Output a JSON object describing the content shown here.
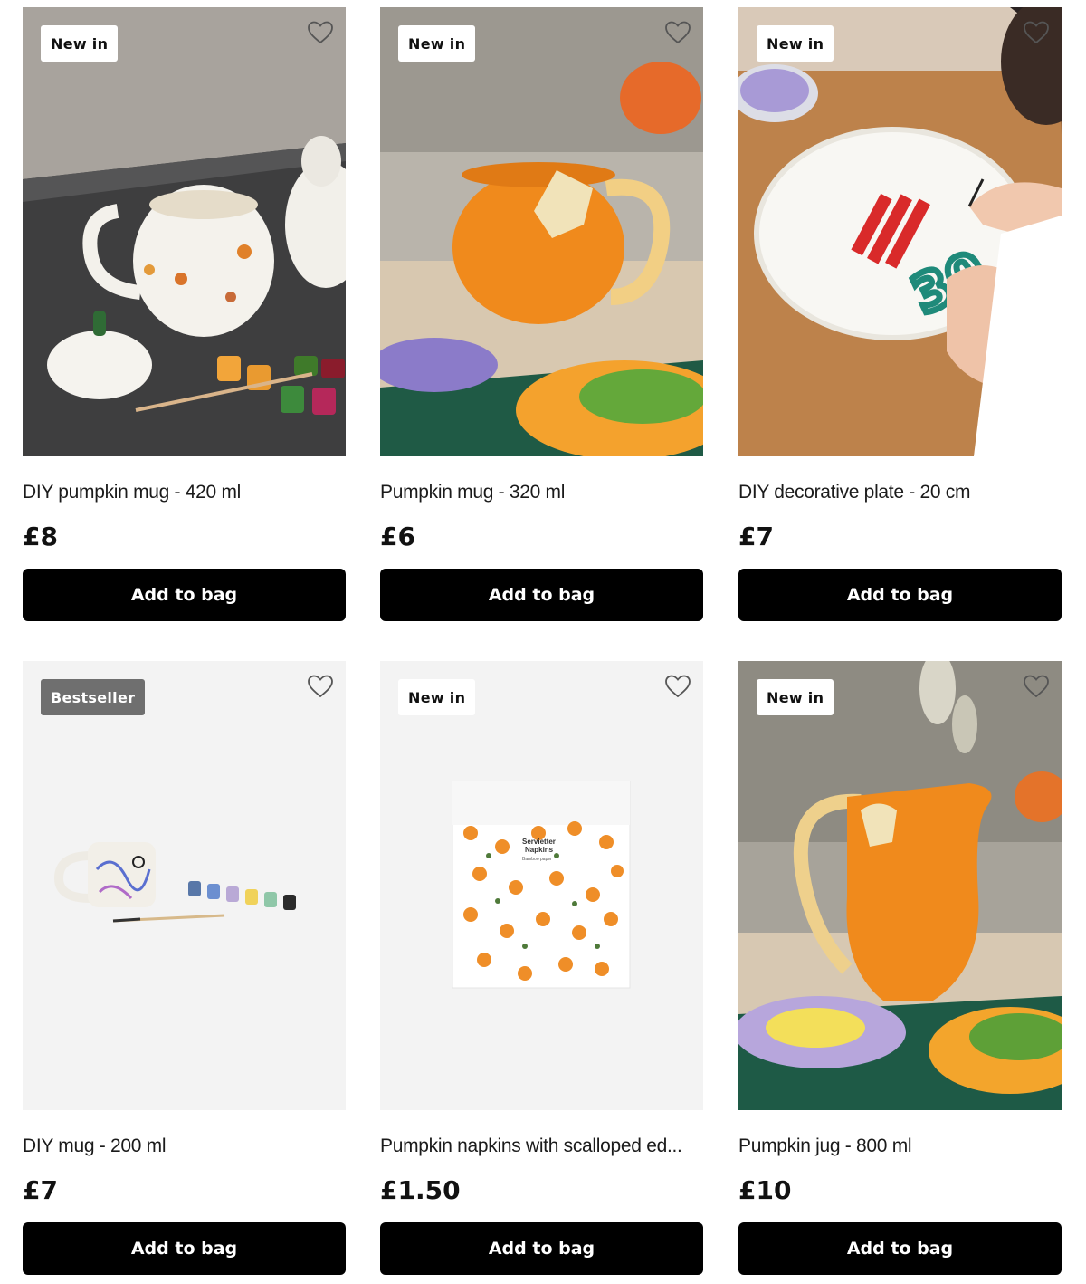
{
  "products": [
    {
      "name": "DIY pumpkin mug - 420 ml",
      "price": "£8",
      "badge": "New in",
      "button": "Add to bag"
    },
    {
      "name": "Pumpkin mug - 320 ml",
      "price": "£6",
      "badge": "New in",
      "button": "Add to bag"
    },
    {
      "name": "DIY decorative plate - 20 cm",
      "price": "£7",
      "badge": "New in",
      "button": "Add to bag"
    },
    {
      "name": "DIY mug - 200 ml",
      "price": "£7",
      "badge": "Bestseller",
      "button": "Add to bag"
    },
    {
      "name": "Pumpkin napkins with scalloped ed...",
      "price": "£1.50",
      "badge": "New in",
      "button": "Add to bag"
    },
    {
      "name": "Pumpkin jug - 800 ml",
      "price": "£10",
      "badge": "New in",
      "button": "Add to bag"
    }
  ],
  "napkin_pack_label": {
    "line1": "Servietter",
    "line2": "Napkins",
    "line3": "Bamboo paper"
  },
  "plate_number": "30",
  "colors": {
    "button_bg": "#000000",
    "badge_bg": "#ffffff",
    "bestseller_bg": "#6f6f6f",
    "pumpkin_orange": "#f08a1c"
  },
  "icons": {
    "favourite": "heart-outline-icon"
  }
}
